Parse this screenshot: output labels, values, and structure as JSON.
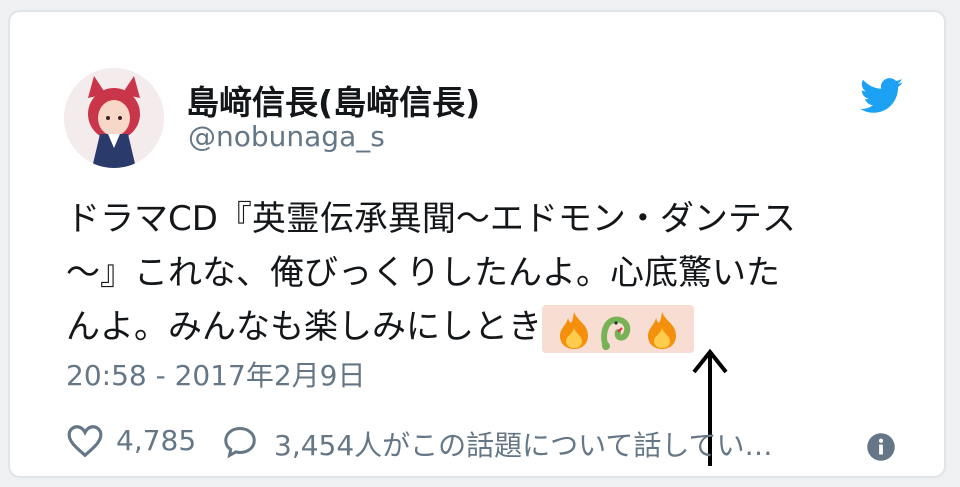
{
  "user": {
    "display_name": "島﨑信長(島﨑信長)",
    "handle": "@nobunaga_s",
    "avatar_icon": "anime-girl-avatar-icon"
  },
  "tweet": {
    "line1": "ドラマCD『英霊伝承異聞〜エドモン・ダンテス",
    "line2": "〜』これな、俺びっくりしたんよ。心底驚いた",
    "line3": "んよ。みんなも楽しみにしとき",
    "emojis": [
      "fire-icon",
      "snake-icon",
      "fire-icon"
    ],
    "timestamp": "20:58 - 2017年2月9日"
  },
  "footer": {
    "likes": "4,785",
    "conversation": "3,454人がこの話題について話してい…"
  },
  "colors": {
    "twitter_blue": "#1da1f2",
    "text": "#14171a",
    "muted": "#657786",
    "highlight": "#f7ddd2"
  }
}
